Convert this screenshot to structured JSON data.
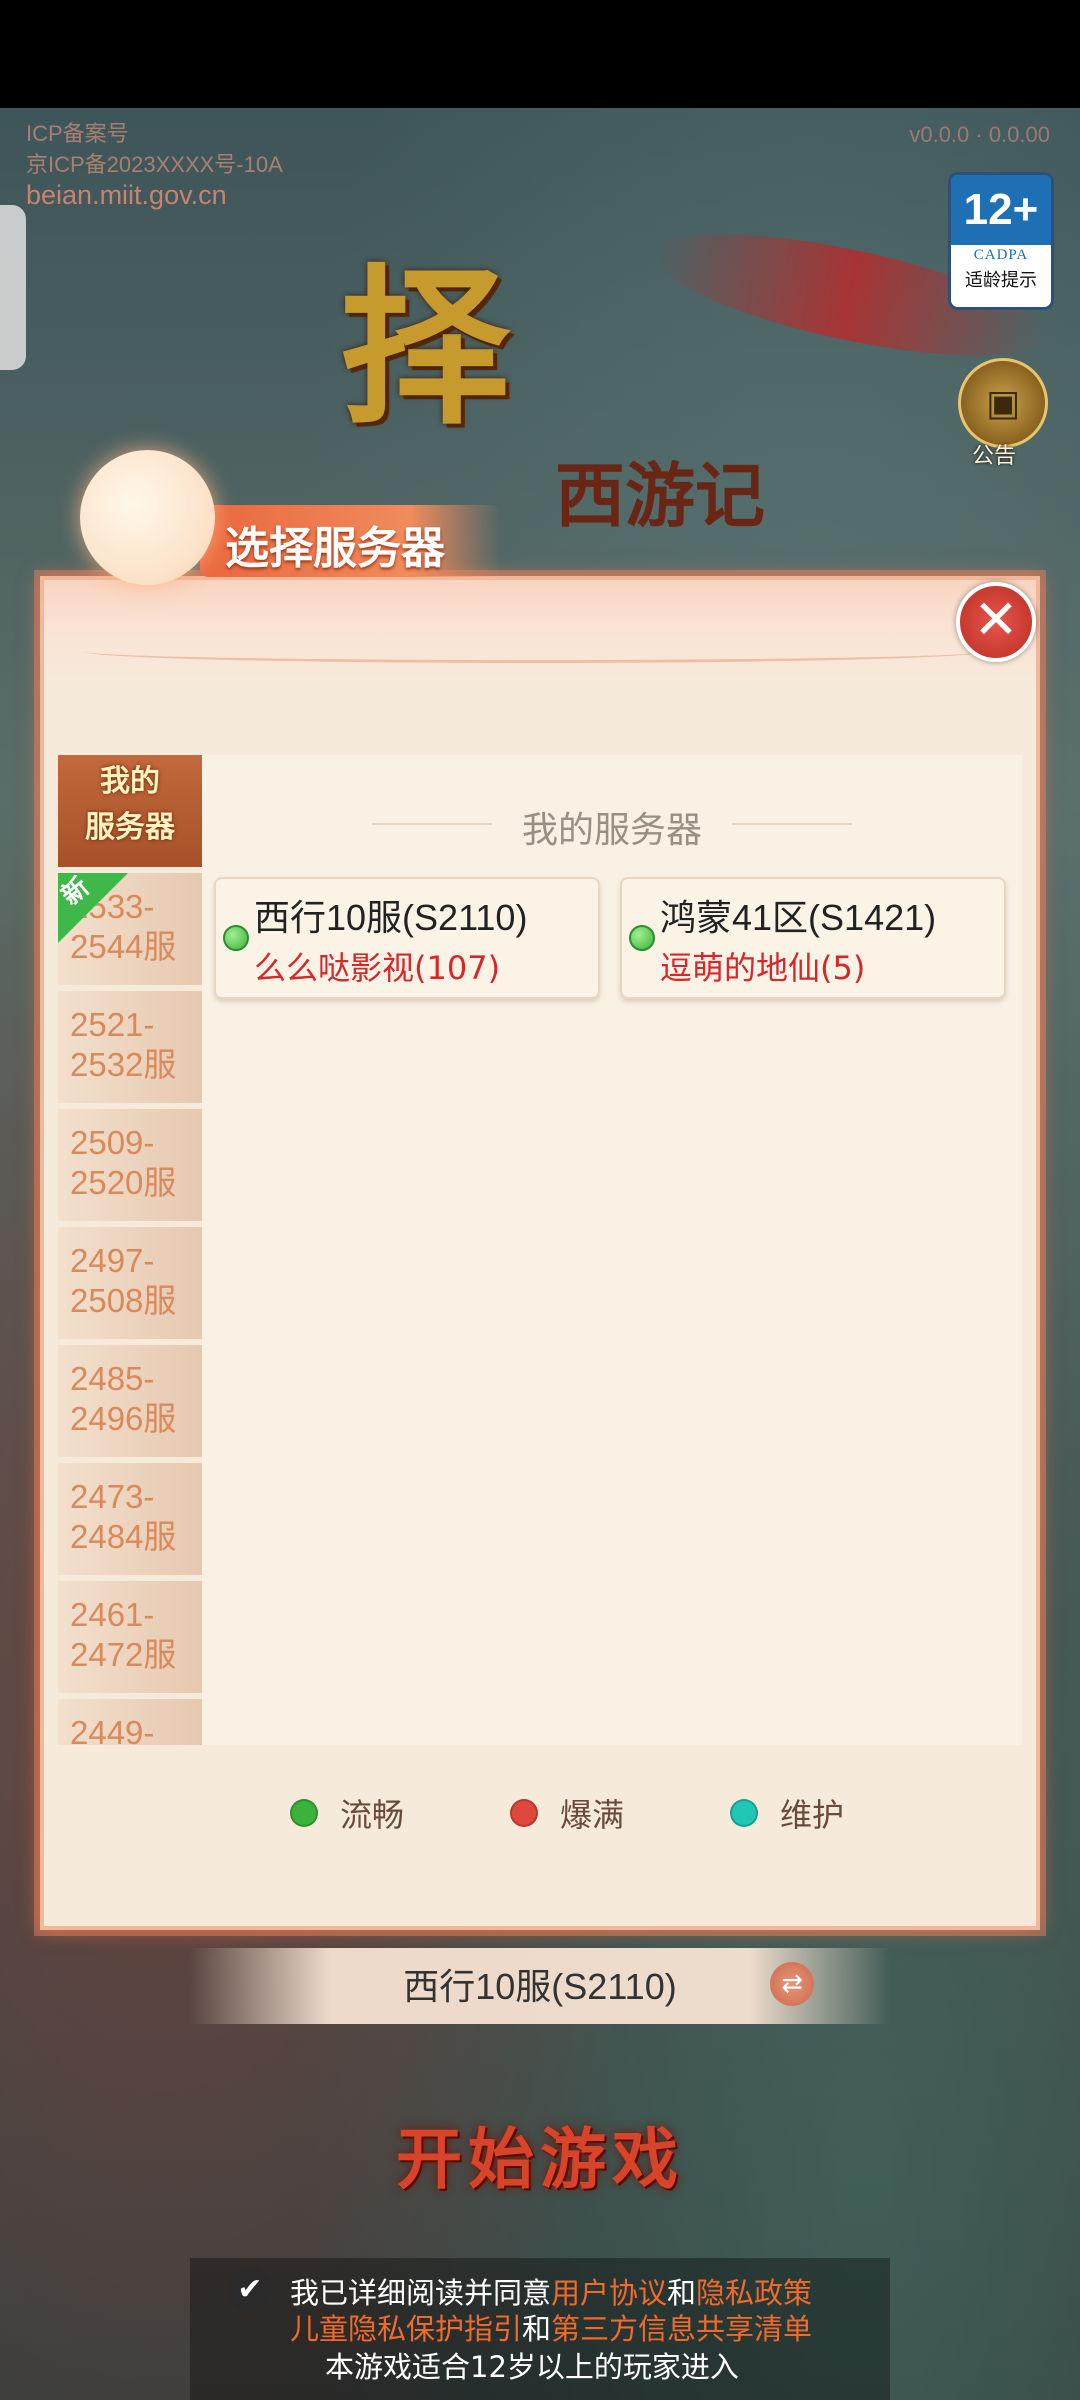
{
  "icp": {
    "line1": "ICP备案号",
    "line2": "京ICP备2023XXXX号-10A",
    "url": "beian.miit.gov.cn"
  },
  "version": "v0.0.0 · 0.0.00",
  "age_rating": {
    "age": "12+",
    "org": "CADPA",
    "tip": "适龄提示"
  },
  "logo": {
    "main": "择",
    "sub": "西游记"
  },
  "notice": {
    "icon": "notice-icon",
    "label": "公告"
  },
  "panel": {
    "title": "选择服务器",
    "close_icon": "close-icon",
    "section_title": "我的服务器"
  },
  "sidebar": {
    "active": {
      "line1": "我的",
      "line2": "服务器"
    },
    "new_badge": "新",
    "items": [
      {
        "line1": "2533-",
        "line2": "2544服"
      },
      {
        "line1": "2521-",
        "line2": "2532服"
      },
      {
        "line1": "2509-",
        "line2": "2520服"
      },
      {
        "line1": "2497-",
        "line2": "2508服"
      },
      {
        "line1": "2485-",
        "line2": "2496服"
      },
      {
        "line1": "2473-",
        "line2": "2484服"
      },
      {
        "line1": "2461-",
        "line2": "2472服"
      },
      {
        "line1": "2449-",
        "line2": ""
      }
    ]
  },
  "servers": [
    {
      "name": "西行10服(S2110)",
      "role": "么么哒影视(107)",
      "status": "流畅"
    },
    {
      "name": "鸿蒙41区(S1421)",
      "role": "逗萌的地仙(5)",
      "status": "流畅"
    }
  ],
  "legend": [
    {
      "label": "流畅",
      "color": "#3bb23a"
    },
    {
      "label": "爆满",
      "color": "#e0473c"
    },
    {
      "label": "维护",
      "color": "#1fc7b7"
    }
  ],
  "selected_server": "西行10服(S2110)",
  "start_button": "开始游戏",
  "agreement": {
    "prefix": "我已详细阅读并同意",
    "user_agreement": "用户协议",
    "and1": "和",
    "privacy_policy": "隐私政策",
    "child_privacy": "儿童隐私保护指引",
    "and2": "和",
    "third_party": "第三方信息共享清单",
    "age_notice": "本游戏适合12岁以上的玩家进入"
  }
}
